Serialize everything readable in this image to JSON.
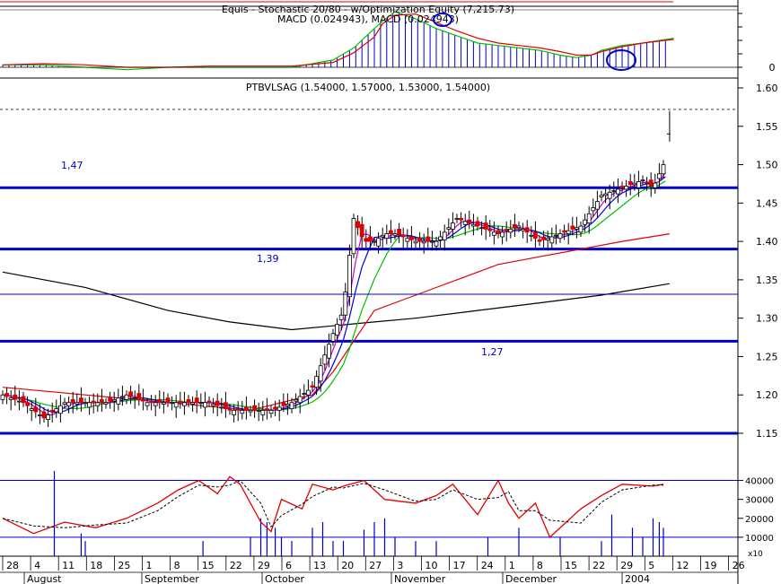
{
  "macd_panel": {
    "title": "Equis - Stochastic 20/80 - w/Optimization Equity (7,215.73)",
    "subtitle": "MACD (0.024943), MACD (0.024943)",
    "axis_label": "0"
  },
  "price_panel": {
    "title": "PTBVLSAG (1.54000, 1.57000, 1.53000, 1.54000)",
    "levels": [
      {
        "value": 1.47,
        "label": "1,47"
      },
      {
        "value": 1.39,
        "label": "1,39"
      },
      {
        "value": 1.27,
        "label": "1,27"
      },
      {
        "value": 1.15,
        "label": ""
      }
    ],
    "ticks": [
      "1.60",
      "1.55",
      "1.50",
      "1.45",
      "1.40",
      "1.35",
      "1.30",
      "1.25",
      "1.20",
      "1.15"
    ]
  },
  "volume_panel": {
    "ticks": [
      "40000",
      "30000",
      "20000",
      "10000"
    ],
    "unit": "x10"
  },
  "x_axis": {
    "days": [
      "28",
      "4",
      "11",
      "18",
      "25",
      "1",
      "8",
      "15",
      "22",
      "29",
      "6",
      "13",
      "20",
      "27",
      "3",
      "10",
      "17",
      "24",
      "1",
      "8",
      "15",
      "22",
      "29",
      "5",
      "12",
      "19",
      "26"
    ],
    "months": [
      "August",
      "September",
      "October",
      "November",
      "December",
      "2004"
    ]
  },
  "colors": {
    "level_line": "#0000d0",
    "ma_black": "#000000",
    "ma_red": "#e00000",
    "ma_green": "#00c000",
    "ma_blue": "#0000e0",
    "ma_magenta": "#d000d0",
    "histogram": "#0000cc",
    "down_candle": "#e00000"
  },
  "chart_data": [
    {
      "type": "line",
      "title": "Equis - Stochastic 20/80 - w/Optimization Equity (7,215.73)",
      "subtitle": "MACD (0.024943), MACD (0.024943)",
      "series": [
        {
          "name": "MACD",
          "x": [
            0,
            20,
            40,
            60,
            80,
            100,
            120,
            140,
            160,
            170,
            180,
            184,
            190,
            200,
            210,
            220,
            230,
            240,
            250,
            260,
            270,
            278,
            285,
            290,
            300,
            310,
            325
          ],
          "y": [
            0.1,
            0.1,
            0.0,
            -0.1,
            0.0,
            0.0,
            0.0,
            0.0,
            0.3,
            0.8,
            1.6,
            1.9,
            2.3,
            2.0,
            1.6,
            1.3,
            1.0,
            0.9,
            0.8,
            0.7,
            0.5,
            0.4,
            0.5,
            0.7,
            0.9,
            1.0,
            1.2
          ]
        }
      ]
    },
    {
      "type": "line",
      "title": "PTBVLSAG (1.54000, 1.57000, 1.53000, 1.54000)",
      "ylim": [
        1.15,
        1.6
      ],
      "series": [
        {
          "name": "Close",
          "x": [
            0,
            10,
            20,
            30,
            40,
            50,
            60,
            70,
            80,
            90,
            100,
            110,
            120,
            130,
            140,
            150,
            160,
            165,
            170,
            175,
            180,
            185,
            190,
            200,
            210,
            220,
            230,
            240,
            250,
            260,
            270,
            280,
            290,
            300,
            310,
            315,
            320,
            323
          ],
          "y": [
            1.2,
            1.19,
            1.17,
            1.19,
            1.19,
            1.19,
            1.2,
            1.19,
            1.19,
            1.19,
            1.19,
            1.18,
            1.18,
            1.18,
            1.19,
            1.21,
            1.28,
            1.31,
            1.43,
            1.4,
            1.4,
            1.41,
            1.41,
            1.4,
            1.4,
            1.43,
            1.42,
            1.41,
            1.42,
            1.4,
            1.41,
            1.42,
            1.46,
            1.47,
            1.48,
            1.47,
            1.5,
            1.54
          ]
        },
        {
          "name": "MA long",
          "x": [
            0,
            40,
            80,
            110,
            140,
            160,
            180,
            200,
            230,
            260,
            290,
            323
          ],
          "y": [
            1.36,
            1.34,
            1.31,
            1.295,
            1.285,
            1.29,
            1.295,
            1.3,
            1.31,
            1.32,
            1.33,
            1.345
          ]
        },
        {
          "name": "MA mid",
          "x": [
            0,
            40,
            80,
            120,
            150,
            160,
            170,
            180,
            200,
            220,
            240,
            260,
            280,
            300,
            323
          ],
          "y": [
            1.21,
            1.2,
            1.19,
            1.18,
            1.2,
            1.23,
            1.27,
            1.31,
            1.33,
            1.35,
            1.37,
            1.38,
            1.39,
            1.4,
            1.41
          ]
        }
      ]
    },
    {
      "type": "bar",
      "ylim": [
        0,
        45000
      ],
      "series": [
        {
          "name": "Volume",
          "x": [
            25,
            38,
            40,
            97,
            120,
            125,
            128,
            132,
            135,
            140,
            150,
            155,
            160,
            165,
            175,
            180,
            185,
            190,
            200,
            210,
            235,
            250,
            270,
            290,
            295,
            305,
            310,
            315,
            318,
            320
          ],
          "y": [
            45000,
            12000,
            8000,
            8000,
            10000,
            20000,
            18000,
            15000,
            10000,
            8000,
            15000,
            18000,
            8000,
            8000,
            14000,
            18000,
            20000,
            10000,
            8000,
            8000,
            10000,
            15000,
            10000,
            8000,
            22000,
            15000,
            10000,
            20000,
            18000,
            15000
          ]
        }
      ]
    }
  ]
}
